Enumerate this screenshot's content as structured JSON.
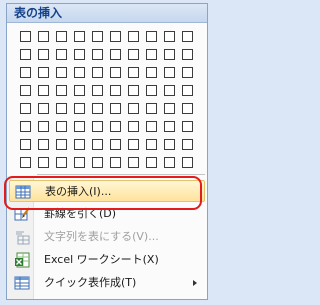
{
  "menu": {
    "title": "表の挿入",
    "grid": {
      "columns": 10,
      "rows": 8
    },
    "items": [
      {
        "label": "表の挿入(I)...",
        "icon": "insert-table-icon",
        "state": "highlighted"
      },
      {
        "label": "罫線を引く(D)",
        "icon": "draw-table-icon",
        "state": "normal"
      },
      {
        "label": "文字列を表にする(V)...",
        "icon": "convert-text-to-table-icon",
        "state": "disabled"
      },
      {
        "label": "Excel ワークシート(X)",
        "icon": "excel-worksheet-icon",
        "state": "normal"
      },
      {
        "label": "クイック表作成(T)",
        "icon": "quick-tables-icon",
        "state": "normal",
        "submenu": true
      }
    ]
  },
  "colors": {
    "header_text": "#15428b",
    "highlight": "#ffe39c",
    "annotation_outline": "#e31b1b"
  }
}
